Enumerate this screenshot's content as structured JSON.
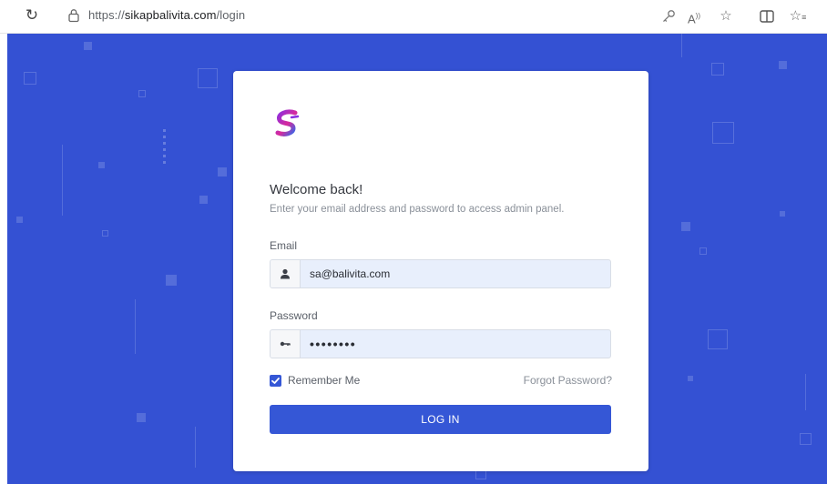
{
  "browser": {
    "url_prefix": "https://",
    "url_domain": "sikapbalivita.com",
    "url_path": "/login",
    "icons": [
      "refresh-icon",
      "lock-icon",
      "key-icon",
      "read-aloud-icon",
      "favorite-icon",
      "split-screen-icon",
      "favorites-list-icon"
    ]
  },
  "login": {
    "title": "Welcome back!",
    "subtitle": "Enter your email address and password to access admin panel.",
    "email_label": "Email",
    "email_value": "sa@balivita.com",
    "password_label": "Password",
    "password_value": "••••••••",
    "remember_label": "Remember Me",
    "remember_checked": true,
    "forgot_label": "Forgot Password?",
    "login_button": "LOG IN"
  },
  "colors": {
    "background": "#3451d3",
    "primary": "#3557d6",
    "input_fill": "#e8effc"
  }
}
